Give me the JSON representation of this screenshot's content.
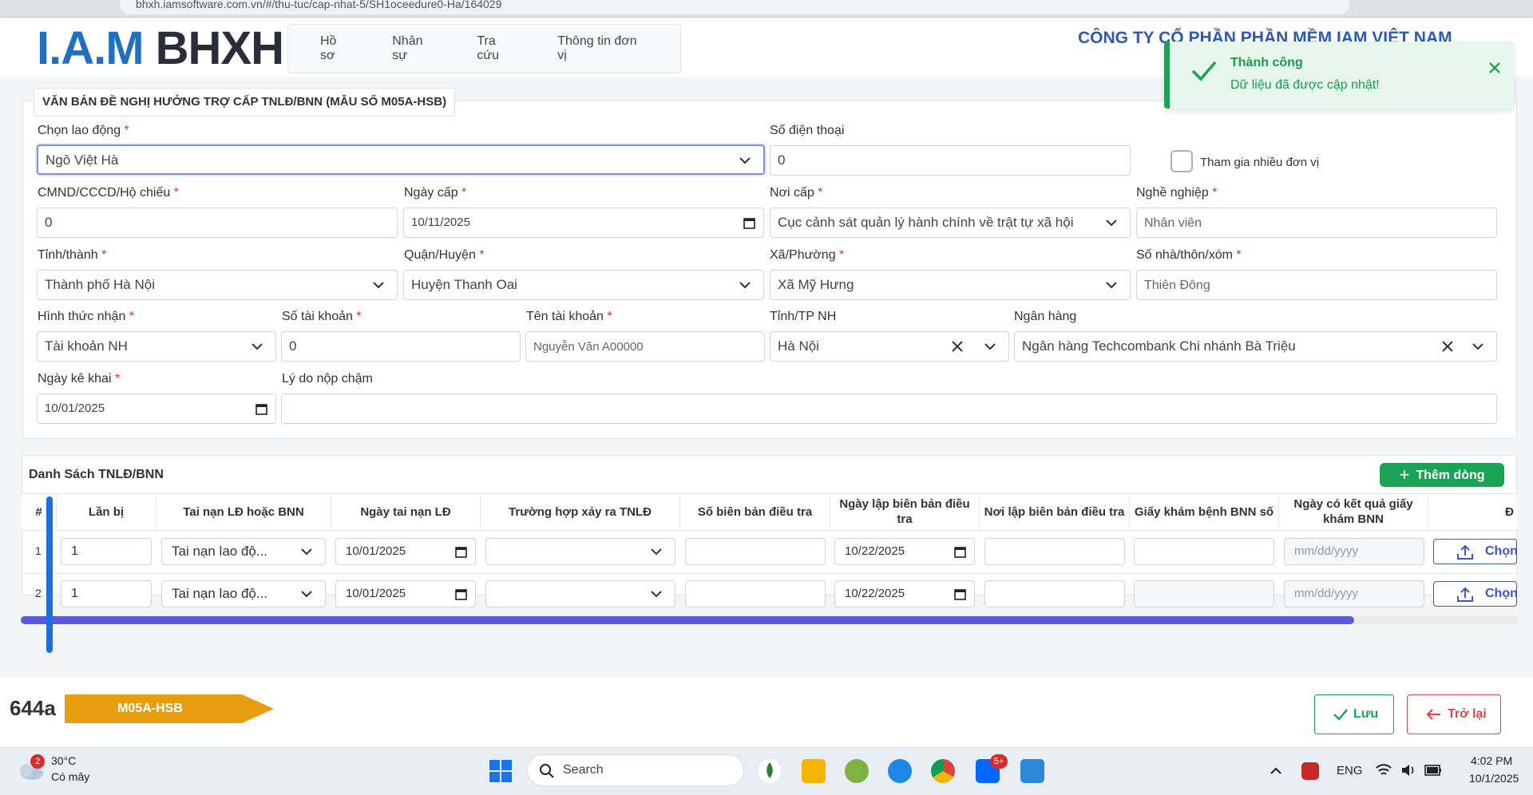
{
  "browser": {
    "url": "bhxh.iamsoftware.com.vn/#/thu-tuc/cap-nhat-5/SH1oceedure0-Ha/164029"
  },
  "header": {
    "logo_part1": "I.A.M",
    "logo_part2": "BHXH",
    "nav": [
      "Hồ sơ",
      "Nhân sự",
      "Tra cứu",
      "Thông tin đơn vị"
    ],
    "company": "CÔNG TY CỔ PHẦN PHẦN MỀM IAM VIỆT NAM"
  },
  "toast": {
    "title": "Thành công",
    "message": "Dữ liệu đã được cập nhật!"
  },
  "form": {
    "title": "VĂN BẢN ĐỀ NGHỊ HƯỞNG TRỢ CẤP TNLĐ/BNN (MẪU SỐ M05A-HSB)",
    "chon_lao_dong": {
      "label": "Chọn lao động",
      "value": "Ngô Việt Hà"
    },
    "so_dien_thoai": {
      "label": "Số điện thoại",
      "value": "0"
    },
    "tham_gia": {
      "label": "Tham gia nhiều đơn vị"
    },
    "cmnd": {
      "label": "CMND/CCCD/Hộ chiếu",
      "value": "0"
    },
    "ngay_cap": {
      "label": "Ngày cấp",
      "value": "10/11/2025"
    },
    "noi_cap": {
      "label": "Nơi cấp",
      "value": "Cục cảnh sát quản lý hành chính về trật tự xã hội"
    },
    "nghe_nghiep": {
      "label": "Nghề nghiệp",
      "value": "Nhân viên"
    },
    "tinh_thanh": {
      "label": "Tỉnh/thành",
      "value": "Thành phố Hà Nội"
    },
    "quan_huyen": {
      "label": "Quận/Huyện",
      "value": "Huyện Thanh Oai"
    },
    "xa_phuong": {
      "label": "Xã/Phường",
      "value": "Xã Mỹ Hưng"
    },
    "so_nha": {
      "label": "Số nhà/thôn/xóm",
      "value": "Thiên Đông"
    },
    "hinh_thuc_nhan": {
      "label": "Hình thức nhận",
      "value": "Tài khoản NH"
    },
    "so_tai_khoan": {
      "label": "Số tài khoản",
      "value": "0"
    },
    "ten_tai_khoan": {
      "label": "Tên tài khoản",
      "placeholder": "Nguyễn Văn A00000"
    },
    "tinh_tp_nh": {
      "label": "Tỉnh/TP NH",
      "value": "Hà Nội"
    },
    "ngan_hang": {
      "label": "Ngân hàng",
      "value": "Ngân hàng Techcombank Chi nhánh Bà Triệu"
    },
    "ngay_ke_khai": {
      "label": "Ngày kê khai",
      "value": "10/01/2025"
    },
    "ly_do": {
      "label": "Lý do nộp chậm",
      "value": ""
    }
  },
  "table": {
    "title": "Danh Sách TNLĐ/BNN",
    "add_label": "Thêm dòng",
    "headers": [
      "#",
      "Lần bị",
      "Tai nạn LĐ hoặc BNN",
      "Ngày tai nạn LĐ",
      "Trường hợp xảy ra TNLĐ",
      "Số biên bản điều tra",
      "Ngày lập biên bản điều tra",
      "Nơi lập biên bản điều tra",
      "Giấy khám bệnh BNN số",
      "Ngày có kết quả giấy khám BNN",
      "Đ"
    ],
    "rows": [
      {
        "index": "1",
        "lan_bi": "1",
        "loai": "Tai nạn lao độ...",
        "ngay_tai_nan": "10/01/2025",
        "ngay_lap": "10/22/2025",
        "ngay_kq_placeholder": "mm/dd/yyyy",
        "pick": "Chọn"
      },
      {
        "index": "2",
        "lan_bi": "1",
        "loai": "Tai nạn lao độ...",
        "ngay_tai_nan": "10/01/2025",
        "ngay_lap": "10/22/2025",
        "ngay_kq_placeholder": "mm/dd/yyyy",
        "pick": "Chọn"
      }
    ],
    "scroll_position": 0.89
  },
  "footer": {
    "code": "644a",
    "tag": "M05A-HSB",
    "save": "Lưu",
    "back": "Trở lại"
  },
  "taskbar": {
    "weather_temp": "30°C",
    "weather_desc": "Có mây",
    "weather_badge": "2",
    "search": "Search",
    "zalo_badge": "5+",
    "lang": "ENG",
    "time": "4:02 PM",
    "date": "10/1/2025"
  },
  "colors": {
    "primary": "#1f70c1",
    "success": "#1aa355",
    "danger": "#d9464b",
    "scroll": "#5b59db",
    "tag": "#e89d10"
  }
}
